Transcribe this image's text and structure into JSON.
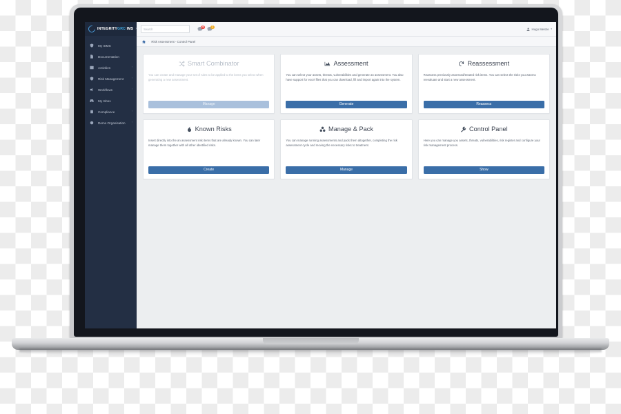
{
  "app": {
    "brand": {
      "logo_icon": "circle-swoosh-icon",
      "name_part1": "INTEGRITY",
      "name_part2": "GRC",
      "name_part3": "IMS",
      "close_label": "×",
      "accent_color": "#3ea9e0",
      "sidebar_color": "#232f44"
    },
    "search": {
      "placeholder": "Search",
      "value": ""
    },
    "notifications": [
      {
        "icon": "message-bubble-icon",
        "count": "20",
        "color": "#e8453c"
      },
      {
        "icon": "megaphone-icon",
        "count": "1",
        "color": "#f0ad28"
      }
    ],
    "user": {
      "icon": "user-icon",
      "name": "Hugo Mestre",
      "caret": "▾"
    },
    "breadcrumb": {
      "home_icon": "home-icon",
      "separator": "·",
      "text": "Risk Assessment - Control Panel"
    }
  },
  "sidebar": {
    "items": [
      {
        "label": "My ISMS",
        "icon": "shield-icon",
        "has_caret": false
      },
      {
        "label": "Documentation",
        "icon": "document-icon",
        "has_caret": false
      },
      {
        "label": "Activities",
        "icon": "grid-icon",
        "has_caret": true
      },
      {
        "label": "Risk Management",
        "icon": "shield-check-icon",
        "has_caret": true
      },
      {
        "label": "Workflows",
        "icon": "flow-icon",
        "has_caret": true
      },
      {
        "label": "My Inbox",
        "icon": "inbox-icon",
        "has_caret": false
      },
      {
        "label": "Compliance",
        "icon": "clipboard-icon",
        "has_caret": true
      },
      {
        "label": "Demo Organisation",
        "icon": "building-icon",
        "has_caret": true
      }
    ],
    "caret_glyph": "›"
  },
  "cards": [
    {
      "id": "smart-combinator",
      "icon": "shuffle-icon",
      "title": "Smart Combinator",
      "description": "You can create and manage your set of rules to be applied to the items you select when generating a new assessment.",
      "button_label": "Manage",
      "disabled": true
    },
    {
      "id": "assessment",
      "icon": "chart-area-icon",
      "title": "Assessment",
      "description": "You can select your assets, threats, vulnerabilities and generate an assessment. You also have support for excel files that you can download, fill and import again into the system.",
      "button_label": "Generate",
      "disabled": false
    },
    {
      "id": "reassessment",
      "icon": "undo-arrow-icon",
      "title": "Reassessment",
      "description": "Reassess previously assessed/treated risk items. You can select the risks you want to reevaluate and start a new assessment.",
      "button_label": "Reassess",
      "disabled": false
    },
    {
      "id": "known-risks",
      "icon": "fire-icon",
      "title": "Known Risks",
      "description": "Insert directly into the an assessment risk items that are already known. You can later manage them together with all other identified risks.",
      "button_label": "Create",
      "disabled": false
    },
    {
      "id": "manage-and-pack",
      "icon": "cubes-icon",
      "title": "Manage & Pack",
      "description": "You can manage running assessments and pack them altogether, completing the risk assessment cycle and moving the necessary risks to treatment.",
      "button_label": "Manage",
      "disabled": false
    },
    {
      "id": "control-panel",
      "icon": "wrench-icon",
      "title": "Control Panel",
      "description": "Here you can manage you assets, threats, vulnerabilities, risk register and configure your risk management process.",
      "button_label": "Show",
      "disabled": false
    }
  ],
  "theme": {
    "primary_button": "#3a6ea8",
    "disabled_button": "#a9c0dc",
    "content_bg": "#eceef0"
  }
}
